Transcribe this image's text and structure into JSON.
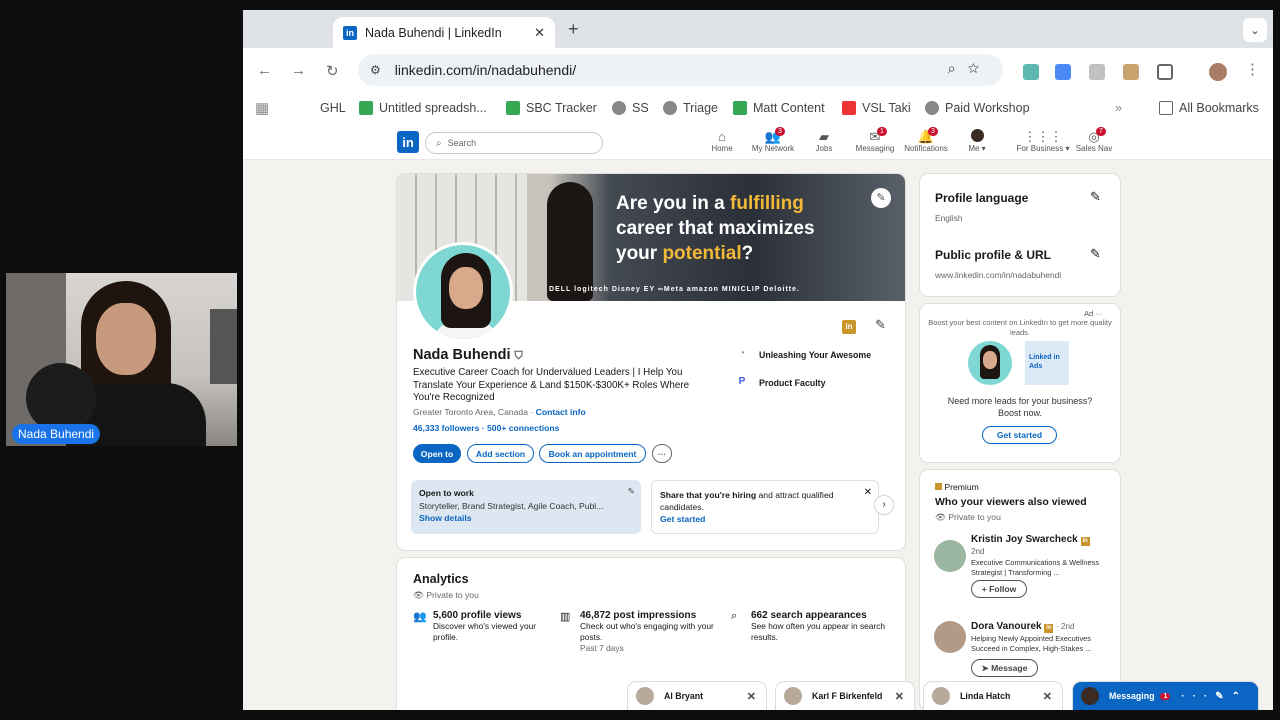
{
  "webcam": {
    "name": "Nada Buhendi"
  },
  "browser": {
    "tab_title": "Nada Buhendi | LinkedIn",
    "favicon": "in",
    "url": "linkedin.com/in/nadabuhendi/",
    "bookmarks": [
      "GHL",
      "Untitled spreadsh...",
      "SBC Tracker",
      "SS",
      "Triage",
      "Matt Content",
      "VSL Taki",
      "Paid Workshop"
    ],
    "all_bookmarks": "All Bookmarks"
  },
  "linkedin_nav": {
    "logo": "in",
    "search_placeholder": "Search",
    "items": [
      {
        "label": "Home",
        "badge": ""
      },
      {
        "label": "My Network",
        "badge": "3"
      },
      {
        "label": "Jobs",
        "badge": ""
      },
      {
        "label": "Messaging",
        "badge": "1"
      },
      {
        "label": "Notifications",
        "badge": "3"
      },
      {
        "label": "Me ▾",
        "badge": ""
      },
      {
        "label": "For Business ▾",
        "badge": ""
      },
      {
        "label": "Sales Nav",
        "badge": "7"
      }
    ]
  },
  "banner": {
    "line1a": "Are you in a ",
    "line1b": "fulfilling",
    "line2": "career that maximizes",
    "line3a": "your ",
    "line3b": "potential",
    "line3c": "?",
    "logos": "DELL   logitech   Disney   EY   ∞Meta   amazon   MINICLIP   Deloitte."
  },
  "profile": {
    "name": "Nada Buhendi",
    "headline": "Executive Career Coach for Undervalued Leaders | I Help You Translate Your Experience & Land $150K-$300K+ Roles Where You're Recognized",
    "location": "Greater Toronto Area, Canada",
    "contact": "Contact info",
    "connections": "46,333 followers · 500+ connections",
    "buttons": [
      "Open to",
      "Add section",
      "Book an appointment"
    ],
    "companies": [
      "Unleashing Your Awesome",
      "Product Faculty"
    ],
    "open_to_work": {
      "title": "Open to work",
      "roles": "Storyteller, Brand Strategist, Agile Coach, Publ...",
      "link": "Show details"
    },
    "hiring": {
      "text_bold": "Share that you're hiring",
      "text": " and attract qualified candidates.",
      "link": "Get started"
    }
  },
  "analytics": {
    "title": "Analytics",
    "private": "Private to you",
    "items": [
      {
        "title": "5,600 profile views",
        "desc": "Discover who's viewed your profile.",
        "extra": ""
      },
      {
        "title": "46,872 post impressions",
        "desc": "Check out who's engaging with your posts.",
        "extra": "Past 7 days"
      },
      {
        "title": "662 search appearances",
        "desc": "See how often you appear in search results.",
        "extra": ""
      }
    ]
  },
  "sidebar": {
    "profile_language": "Profile language",
    "language": "English",
    "public_profile": "Public profile & URL",
    "public_url": "www.linkedin.com/in/nadabuhendi",
    "ad_label": "Ad",
    "ad_text": "Boost your best content on LinkedIn to get more quality leads.",
    "ad_badge": "Linked in Ads",
    "ad_question": "Need more leads for your business? Boost now.",
    "ad_button": "Get started",
    "premium": "Premium",
    "viewers_title": "Who your viewers also viewed",
    "viewers_private": "Private to you",
    "people": [
      {
        "name": "Kristin Joy Swarcheck",
        "degree": "2nd",
        "desc": "Executive Communications & Wellness Strategist | Transforming ...",
        "action": "+ Follow"
      },
      {
        "name": "Dora Vanourek",
        "degree": "· 2nd",
        "desc": "Helping Newly Appointed Executives Succeed in Complex, High-Stakes ...",
        "action": "➤ Message"
      }
    ]
  },
  "messaging": {
    "chats": [
      "Al Bryant",
      "Karl F Birkenfeld",
      "Linda Hatch"
    ],
    "main": "Messaging",
    "main_badge": "1"
  }
}
